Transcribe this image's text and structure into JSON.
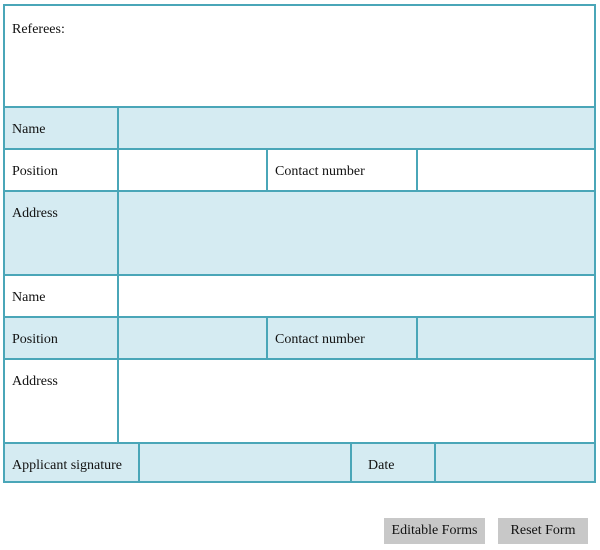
{
  "form": {
    "referees_label": "Referees:",
    "referee1": {
      "name_label": "Name",
      "name_value": "",
      "position_label": "Position",
      "position_value": "",
      "contact_label": "Contact number",
      "contact_value": "",
      "address_label": "Address",
      "address_value": ""
    },
    "referee2": {
      "name_label": "Name",
      "name_value": "",
      "position_label": "Position",
      "position_value": "",
      "contact_label": "Contact number",
      "contact_value": "",
      "address_label": "Address",
      "address_value": ""
    },
    "signature_label": "Applicant signature",
    "signature_value": "",
    "date_label": "Date",
    "date_value": ""
  },
  "buttons": {
    "editable_label": "Editable Forms",
    "reset_label": "Reset Form"
  },
  "colors": {
    "border": "#4aa6b8",
    "field_fill": "#d5ebf2",
    "button": "#c8c8c8"
  }
}
